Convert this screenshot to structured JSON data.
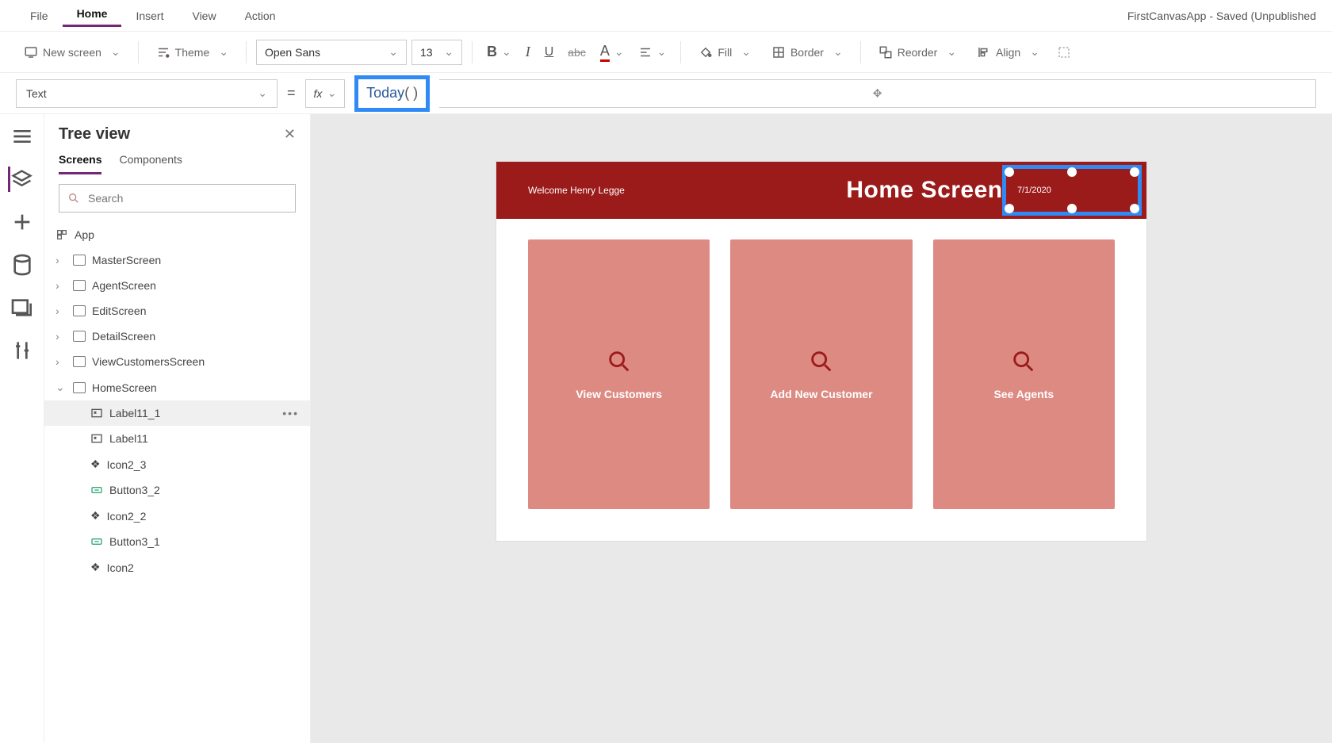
{
  "app_title": "FirstCanvasApp - Saved (Unpublished",
  "menu": {
    "file": "File",
    "home": "Home",
    "insert": "Insert",
    "view": "View",
    "action": "Action"
  },
  "ribbon": {
    "new_screen": "New screen",
    "theme": "Theme",
    "font": "Open Sans",
    "font_size": "13",
    "fill": "Fill",
    "border": "Border",
    "reorder": "Reorder",
    "align": "Align"
  },
  "formula": {
    "property": "Text",
    "fx": "fx",
    "fn": "Today",
    "paren": "( )"
  },
  "panel": {
    "title": "Tree view",
    "tabs": {
      "screens": "Screens",
      "components": "Components"
    },
    "search_placeholder": "Search"
  },
  "tree": {
    "app": "App",
    "screens": [
      {
        "name": "MasterScreen"
      },
      {
        "name": "AgentScreen"
      },
      {
        "name": "EditScreen"
      },
      {
        "name": "DetailScreen"
      },
      {
        "name": "ViewCustomersScreen"
      },
      {
        "name": "HomeScreen",
        "expanded": true,
        "children": [
          {
            "name": "Label11_1",
            "icon": "edit",
            "selected": true
          },
          {
            "name": "Label11",
            "icon": "edit"
          },
          {
            "name": "Icon2_3",
            "icon": "misc"
          },
          {
            "name": "Button3_2",
            "icon": "btn"
          },
          {
            "name": "Icon2_2",
            "icon": "misc"
          },
          {
            "name": "Button3_1",
            "icon": "btn"
          },
          {
            "name": "Icon2",
            "icon": "misc"
          }
        ]
      }
    ]
  },
  "canvas": {
    "welcome": "Welcome Henry Legge",
    "title": "Home Screen",
    "date": "7/1/2020",
    "cards": [
      {
        "label": "View Customers"
      },
      {
        "label": "Add New Customer"
      },
      {
        "label": "See Agents"
      }
    ]
  }
}
